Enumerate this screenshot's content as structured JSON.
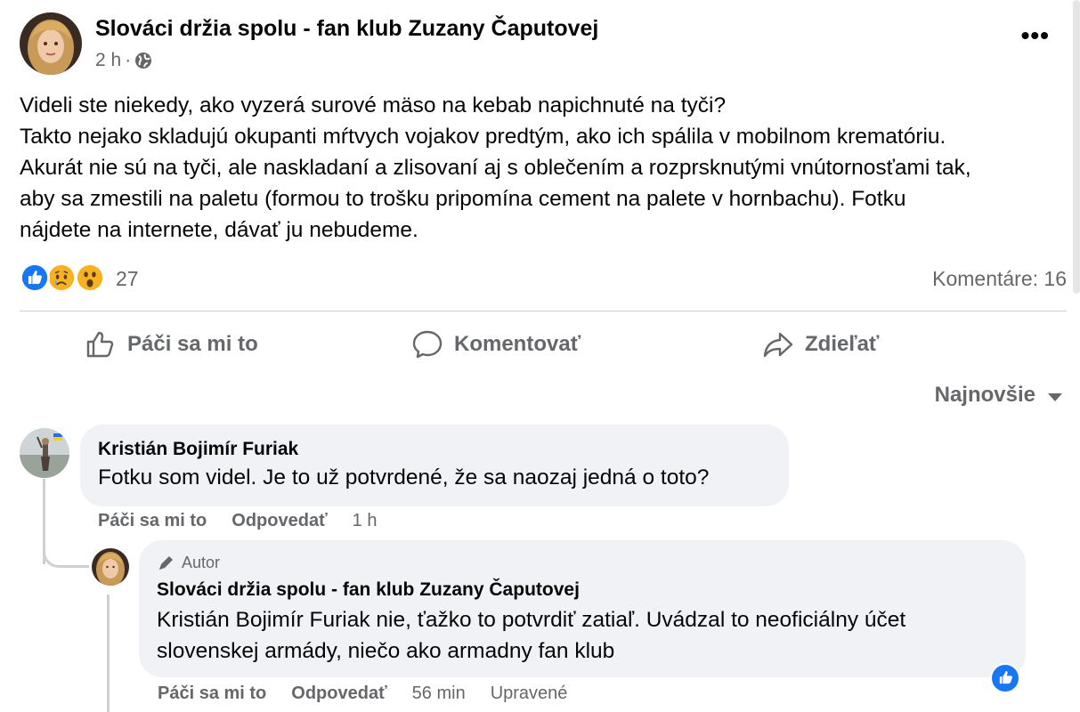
{
  "post": {
    "title": "Slováci držia spolu - fan klub Zuzany Čaputovej",
    "time": "2 h",
    "separator": "·",
    "body_lines": [
      "Videli ste niekedy, ako vyzerá surové mäso na kebab napichnuté na tyči?",
      "Takto nejako skladujú okupanti mŕtvych vojakov predtým, ako ich spálila v mobilnom krematóriu.",
      "Akurát nie sú na tyči, ale naskladaní a zlisovaní aj s oblečením a rozprsknutými vnútornosťami tak,",
      "aby sa zmestili na paletu (formou to trošku pripomína cement na palete v hornbachu). Fotku",
      "nájdete na internete, dávať ju nebudeme."
    ],
    "reactions": [
      "like-icon",
      "sad-icon",
      "wow-icon"
    ],
    "reaction_count": "27",
    "comment_count": "Komentáre: 16"
  },
  "actions": {
    "like": "Páči sa mi to",
    "comment": "Komentovať",
    "share": "Zdieľať"
  },
  "sort": {
    "selected": "Najnovšie"
  },
  "comments": [
    {
      "author": "Kristián Bojimír Furiak",
      "text": "Fotku som videl. Je to už potvrdené, že sa naozaj jedná o toto?",
      "like": "Páči sa mi to",
      "reply": "Odpovedať",
      "time": "1 h"
    },
    {
      "badge": "Autor",
      "author": "Slováci držia spolu - fan klub Zuzany Čaputovej",
      "text_lines": [
        "Kristián Bojimír Furiak nie, ťažko to potvrdiť zatiaľ. Uvádzal to neoficiálny účet",
        "slovenskej armády, niečo ako armadny fan klub"
      ],
      "like": "Páči sa mi to",
      "reply": "Odpovedať",
      "time": "56 min",
      "edited": "Upravené"
    }
  ],
  "colors": {
    "accent": "#1877f2",
    "secondary_text": "#65676b",
    "bubble": "#f0f2f5"
  }
}
